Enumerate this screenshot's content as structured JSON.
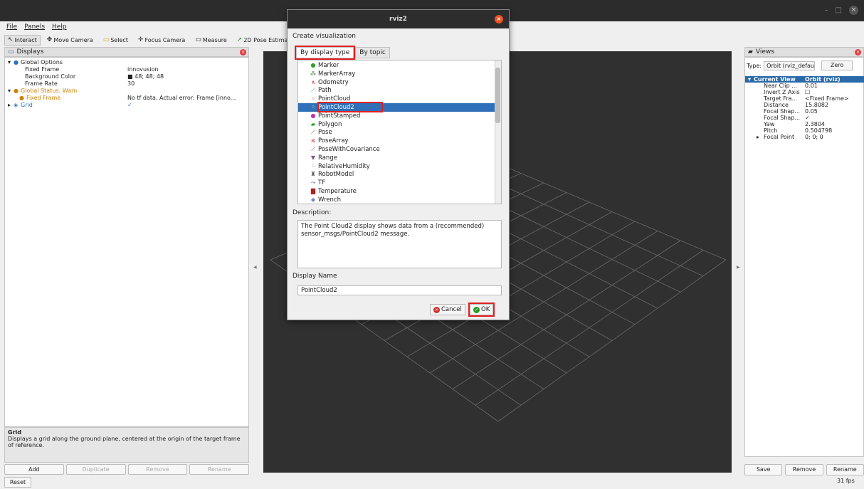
{
  "window": {
    "close_label": "×"
  },
  "menu": {
    "items": [
      "File",
      "Panels",
      "Help"
    ]
  },
  "toolbar": {
    "items": [
      {
        "icon": "↖",
        "label": "Interact"
      },
      {
        "icon": "✥",
        "label": "Move Camera"
      },
      {
        "icon": "▭",
        "label": "Select"
      },
      {
        "icon": "✛",
        "label": "Focus Camera"
      },
      {
        "icon": "▭",
        "label": "Measure"
      },
      {
        "icon": "➚",
        "label": "2D Pose Estimate"
      }
    ]
  },
  "displays": {
    "title": "Displays",
    "rows": [
      {
        "key": "Global Options",
        "value": "",
        "arrow": "▾",
        "icon": "●"
      },
      {
        "key": "Fixed Frame",
        "value": "innovusion"
      },
      {
        "key": "Background Color",
        "value": "■ 48; 48; 48"
      },
      {
        "key": "Frame Rate",
        "value": "30"
      },
      {
        "key": "Global Status: Warn",
        "value": "",
        "arrow": "▾",
        "icon": "●"
      },
      {
        "key": "Fixed Frame",
        "value": "No tf data.  Actual error: Frame [inno..."
      },
      {
        "key": "Grid",
        "value": "✓",
        "arrow": "▸",
        "icon": "◈"
      }
    ],
    "desc_title": "Grid",
    "desc_text": "Displays a grid along the ground plane, centered at the origin of the target frame of reference.",
    "buttons": [
      "Add",
      "Duplicate",
      "Remove",
      "Rename"
    ],
    "reset": "Reset"
  },
  "views": {
    "title": "Views",
    "type_label": "Type:",
    "type_value": "Orbit (rviz_defau",
    "zero": "Zero",
    "rows": [
      {
        "key": "Current View",
        "value": "Orbit (rviz)"
      },
      {
        "key": "Near Clip ...",
        "value": "0.01"
      },
      {
        "key": "Invert Z Axis",
        "value": "☐"
      },
      {
        "key": "Target Fra...",
        "value": "<Fixed Frame>"
      },
      {
        "key": "Distance",
        "value": "15.8082"
      },
      {
        "key": "Focal Shap...",
        "value": "0.05"
      },
      {
        "key": "Focal Shap...",
        "value": "✓"
      },
      {
        "key": "Yaw",
        "value": "2.3804"
      },
      {
        "key": "Pitch",
        "value": "0.504798"
      },
      {
        "key": "Focal Point",
        "value": "0; 0; 0"
      }
    ],
    "buttons": [
      "Save",
      "Remove",
      "Rename"
    ],
    "fps": "31 fps"
  },
  "dialog": {
    "title": "rviz2",
    "heading": "Create visualization",
    "tabs": [
      "By display type",
      "By topic"
    ],
    "items": [
      {
        "icon": "●",
        "color": "#2ea02e",
        "label": "Marker"
      },
      {
        "icon": "⁂",
        "color": "#3a7a2a",
        "label": "MarkerArray"
      },
      {
        "icon": "∧",
        "color": "#d02020",
        "label": "Odometry"
      },
      {
        "icon": "⟋",
        "color": "#40a040",
        "label": "Path"
      },
      {
        "icon": "⁘",
        "color": "#c04040",
        "label": "PointCloud"
      },
      {
        "icon": "⁘",
        "color": "#ffffff",
        "label": "PointCloud2"
      },
      {
        "icon": "●",
        "color": "#c030c0",
        "label": "PointStamped"
      },
      {
        "icon": "▰",
        "color": "#1a9a1a",
        "label": "Polygon"
      },
      {
        "icon": "⟋",
        "color": "#d02020",
        "label": "Pose"
      },
      {
        "icon": "≼",
        "color": "#d02020",
        "label": "PoseArray"
      },
      {
        "icon": "⟋",
        "color": "#c0206a",
        "label": "PoseWithCovariance"
      },
      {
        "icon": "▼",
        "color": "#7a5a9a",
        "label": "Range"
      },
      {
        "icon": "⁘",
        "color": "#7050d0",
        "label": "RelativeHumidity"
      },
      {
        "icon": "♜",
        "color": "#555555",
        "label": "RobotModel"
      },
      {
        "icon": "⤳",
        "color": "#3050a0",
        "label": "TF"
      },
      {
        "icon": "▇",
        "color": "#b02020",
        "label": "Temperature"
      },
      {
        "icon": "◆",
        "color": "#6a8ad0",
        "label": "Wrench"
      }
    ],
    "selected_index": 5,
    "description_label": "Description:",
    "description_text": "The Point Cloud2 display shows data from a (recommended) sensor_msgs/PointCloud2 message.",
    "name_label": "Display Name",
    "name_value": "PointCloud2",
    "cancel": "Cancel",
    "ok": "OK"
  },
  "colors": {
    "accent": "#2f70b8",
    "highlight": "#e02020",
    "viewport_bg": "#303030"
  }
}
